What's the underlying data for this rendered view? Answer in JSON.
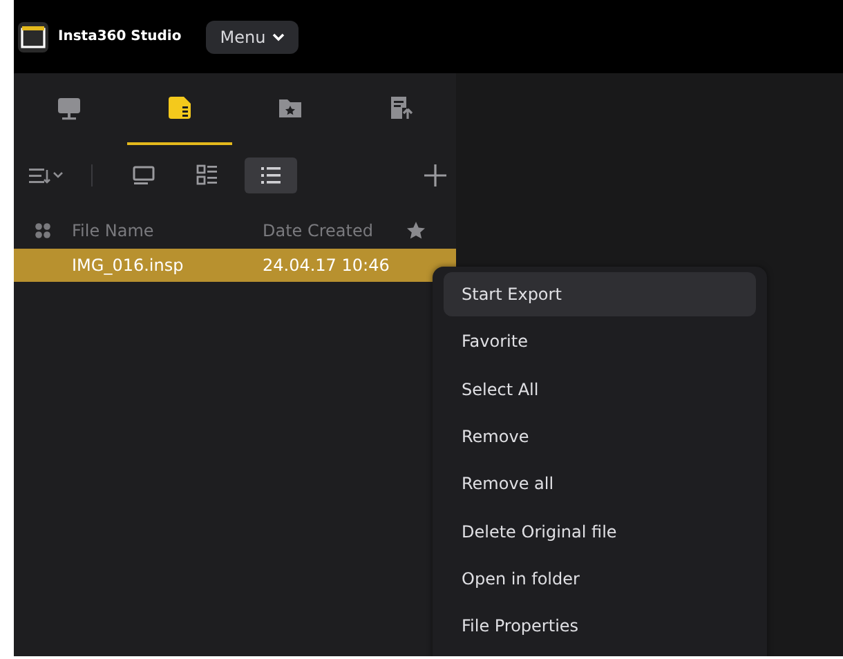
{
  "app": {
    "title": "Insta360 Studio",
    "menu_button": "Menu"
  },
  "tabs": [
    {
      "selected": false
    },
    {
      "selected": true
    },
    {
      "selected": false
    },
    {
      "selected": false
    }
  ],
  "view_buttons": [
    {
      "selected": false
    },
    {
      "selected": false
    },
    {
      "selected": true
    }
  ],
  "table": {
    "columns": [
      "File Name",
      "Date Created"
    ],
    "rows": [
      {
        "name": "IMG_016.insp",
        "date": "24.04.17 10:46",
        "selected": true
      }
    ]
  },
  "context_menu": [
    {
      "label": "Start Export",
      "selected": true
    },
    {
      "label": "Favorite",
      "selected": false
    },
    {
      "label": "Select All",
      "selected": false
    },
    {
      "label": "Remove",
      "selected": false
    },
    {
      "label": "Remove all",
      "selected": false
    },
    {
      "label": "Delete Original file",
      "selected": false
    },
    {
      "label": "Open in folder",
      "selected": false
    },
    {
      "label": "File Properties",
      "selected": false
    }
  ]
}
